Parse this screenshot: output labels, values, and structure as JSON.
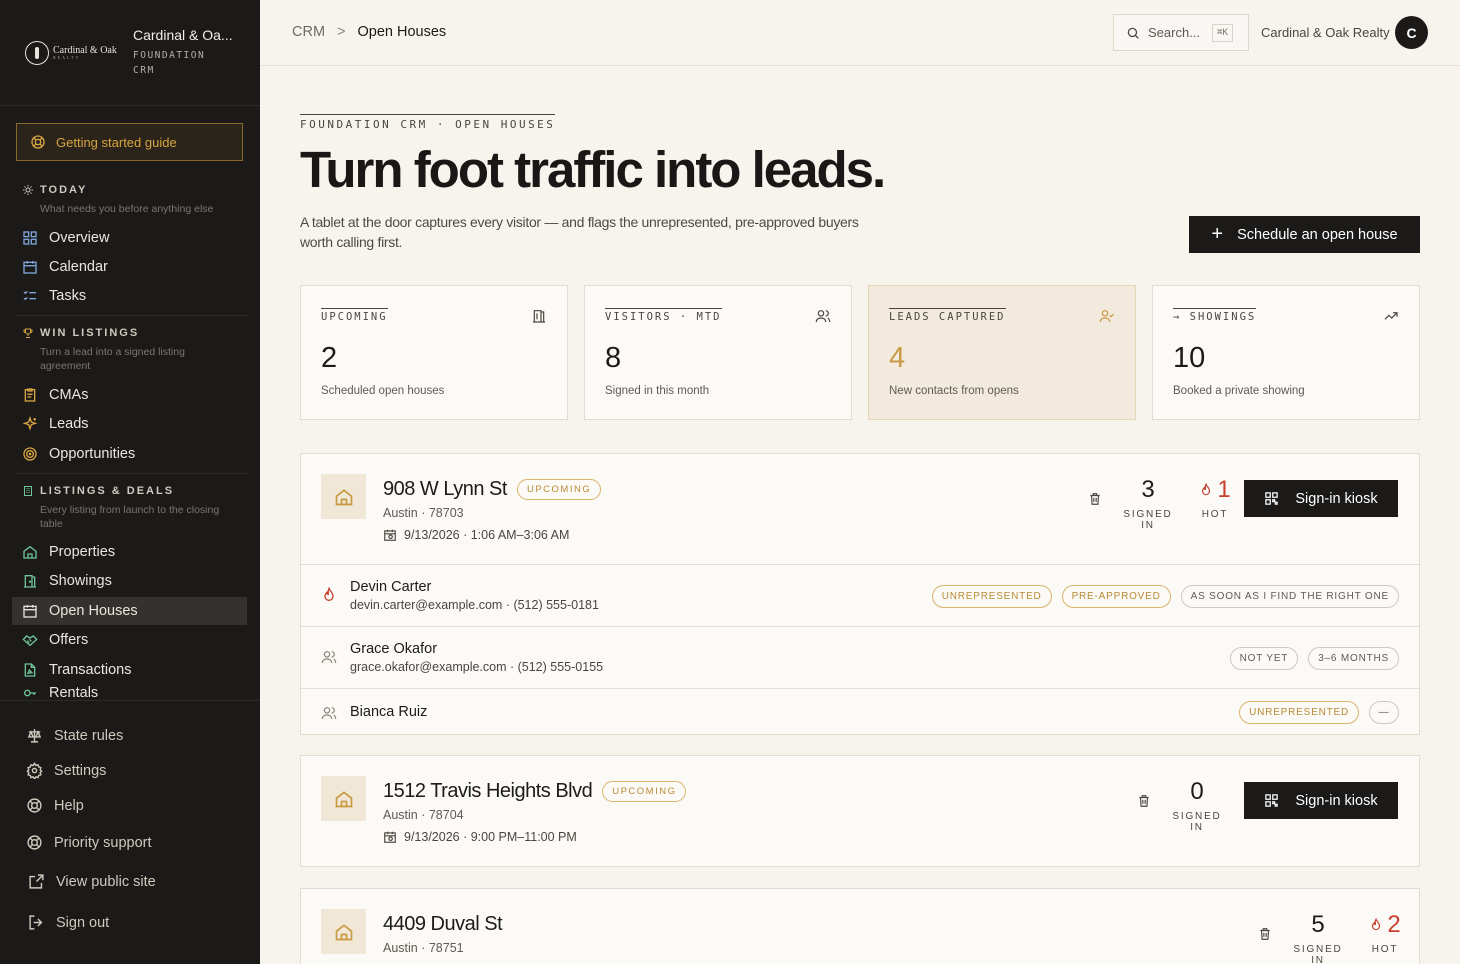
{
  "brand": {
    "logo_name": "Cardinal & Oak",
    "logo_sub": "REALTY",
    "title": "Cardinal & Oa...",
    "subtitle": "FOUNDATION CRM"
  },
  "sidebar": {
    "guide": "Getting started guide",
    "sections": [
      {
        "title": "TODAY",
        "desc": "What needs you before anything else",
        "items": [
          "Overview",
          "Calendar",
          "Tasks"
        ]
      },
      {
        "title": "WIN LISTINGS",
        "desc": "Turn a lead into a signed listing agreement",
        "items": [
          "CMAs",
          "Leads",
          "Opportunities"
        ]
      },
      {
        "title": "LISTINGS & DEALS",
        "desc": "Every listing from launch to the closing table",
        "items": [
          "Properties",
          "Showings",
          "Open Houses",
          "Offers",
          "Transactions",
          "Rentals"
        ]
      }
    ],
    "active": "Open Houses",
    "bottom": [
      "State rules",
      "Settings",
      "Help",
      "Priority support",
      "View public site",
      "Sign out"
    ]
  },
  "topbar": {
    "crumb_root": "CRM",
    "crumb_sep": ">",
    "crumb_current": "Open Houses",
    "search_placeholder": "Search...",
    "search_shortcut": "⌘K",
    "org": "Cardinal & Oak Realty",
    "avatar": "C"
  },
  "hero": {
    "eyebrow": "FOUNDATION CRM · OPEN HOUSES",
    "title": "Turn foot traffic into leads.",
    "lede": "A tablet at the door captures every visitor — and flags the unrepresented, pre-approved buyers worth calling first.",
    "cta_icon": "+",
    "cta": "Schedule an open house"
  },
  "stats": [
    {
      "label": "UPCOMING",
      "value": "2",
      "desc": "Scheduled open houses",
      "icon": "building-icon"
    },
    {
      "label": "VISITORS · MTD",
      "value": "8",
      "desc": "Signed in this month",
      "icon": "users-icon"
    },
    {
      "label": "LEADS CAPTURED",
      "value": "4",
      "desc": "New contacts from opens",
      "icon": "user-check-icon"
    },
    {
      "label": "→ SHOWINGS",
      "value": "10",
      "desc": "Booked a private showing",
      "icon": "trending-up-icon"
    }
  ],
  "listings": [
    {
      "address": "908 W Lynn St",
      "status": "UPCOMING",
      "city": "Austin · 78703",
      "when": "9/13/2026 · 1:06 AM–3:06 AM",
      "signed_in": "3",
      "signed_label": "SIGNED IN",
      "hot": "1",
      "hot_label": "HOT",
      "kiosk": "Sign-in kiosk",
      "visitors": [
        {
          "name": "Devin Carter",
          "meta": "devin.carter@example.com · (512) 555-0181",
          "hot": true,
          "tags": [
            "UNREPRESENTED",
            "PRE-APPROVED",
            "AS SOON AS I FIND THE RIGHT ONE"
          ]
        },
        {
          "name": "Grace Okafor",
          "meta": "grace.okafor@example.com · (512) 555-0155",
          "hot": false,
          "tags": [
            "NOT YET",
            "3–6 MONTHS"
          ]
        },
        {
          "name": "Bianca Ruiz",
          "meta": "",
          "hot": false,
          "tags": [
            "UNREPRESENTED",
            "—"
          ]
        }
      ]
    },
    {
      "address": "1512 Travis Heights Blvd",
      "status": "UPCOMING",
      "city": "Austin · 78704",
      "when": "9/13/2026 · 9:00 PM–11:00 PM",
      "signed_in": "0",
      "signed_label": "SIGNED IN",
      "kiosk": "Sign-in kiosk"
    },
    {
      "address": "4409 Duval St",
      "city": "Austin · 78751",
      "signed_in": "5",
      "signed_label": "SIGNED IN",
      "hot": "2",
      "hot_label": "HOT"
    }
  ]
}
